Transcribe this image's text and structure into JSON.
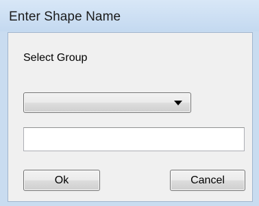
{
  "window": {
    "title": "Enter Shape Name"
  },
  "form": {
    "group_label": "Select Group",
    "group_select": {
      "selected_value": "",
      "icon": "chevron-down-icon"
    },
    "name_input": {
      "value": "",
      "placeholder": ""
    }
  },
  "buttons": {
    "ok_label": "Ok",
    "cancel_label": "Cancel"
  },
  "colors": {
    "titlebar": "#c9dcf0",
    "client_background": "#f0f0f0"
  }
}
